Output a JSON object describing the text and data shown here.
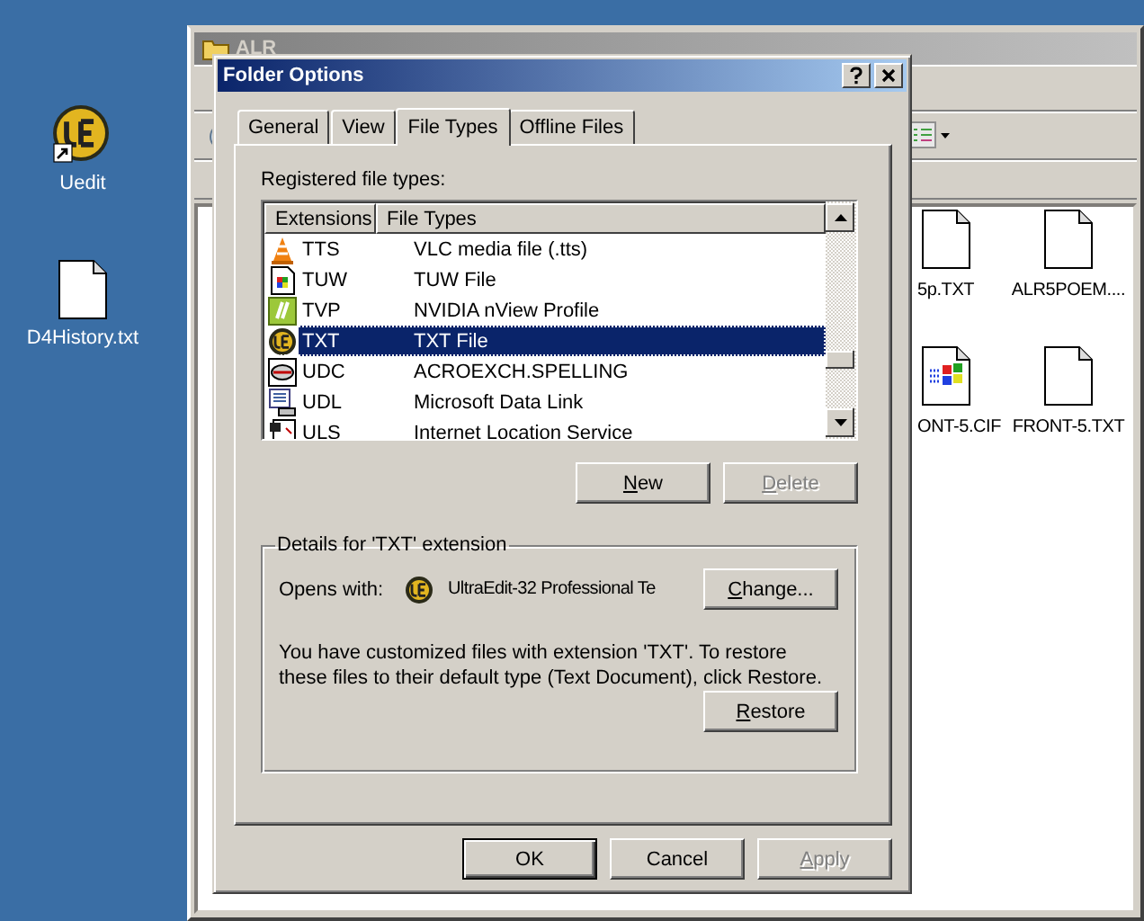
{
  "desktop_icons": [
    {
      "label": "Uedit",
      "kind": "app-shortcut"
    },
    {
      "label": "D4History.txt",
      "kind": "document"
    }
  ],
  "explorer": {
    "title": "ALR",
    "files": [
      {
        "label": "5p.TXT",
        "kind": "document"
      },
      {
        "label": "ALR5POEM....",
        "kind": "document"
      },
      {
        "label": "ONT-5.CIF",
        "kind": "setup"
      },
      {
        "label": "FRONT-5.TXT",
        "kind": "document"
      }
    ]
  },
  "dialog": {
    "title": "Folder Options",
    "tabs": [
      {
        "label": "General",
        "selected": false
      },
      {
        "label": "View",
        "selected": false
      },
      {
        "label": "File Types",
        "selected": true
      },
      {
        "label": "Offline Files",
        "selected": false
      }
    ],
    "list_label": "Registered file types:",
    "columns": [
      "Extensions",
      "File Types"
    ],
    "rows": [
      {
        "extension": "TTS",
        "file_type": "VLC media file (.tts)",
        "kind": "cone",
        "selected": false
      },
      {
        "extension": "TUW",
        "file_type": "TUW File",
        "kind": "windows-doc",
        "selected": false
      },
      {
        "extension": "TVP",
        "file_type": "NVIDIA nView Profile",
        "kind": "green-tile",
        "selected": false
      },
      {
        "extension": "TXT",
        "file_type": "TXT File",
        "kind": "ue",
        "selected": true
      },
      {
        "extension": "UDC",
        "file_type": "ACROEXCH.SPELLING",
        "kind": "disk",
        "selected": false
      },
      {
        "extension": "UDL",
        "file_type": "Microsoft Data Link",
        "kind": "datalink",
        "selected": false
      },
      {
        "extension": "ULS",
        "file_type": "Internet Location Service",
        "kind": "web",
        "selected": false
      }
    ],
    "list_buttons": [
      {
        "label": "New",
        "underlined_first": true,
        "disabled": false
      },
      {
        "label": "Delete",
        "underlined_first": true,
        "disabled": true
      }
    ],
    "details": {
      "legend": "Details for 'TXT' extension",
      "opens_with_label": "Opens with:",
      "app_name": "UltraEdit-32 Professional Te",
      "change_button": {
        "label": "Change...",
        "underlined_first": true,
        "disabled": false
      },
      "note": "You have customized files with extension 'TXT'.  To restore these files to their default type (Text Document), click Restore.",
      "restore_button": {
        "label": "Restore",
        "underlined_first": true,
        "disabled": false
      }
    },
    "buttons": [
      {
        "label": "OK",
        "underlined_first": false,
        "disabled": false,
        "default": true
      },
      {
        "label": "Cancel",
        "underlined_first": false,
        "disabled": false,
        "default": false
      },
      {
        "label": "Apply",
        "underlined_first": true,
        "disabled": true,
        "default": false
      }
    ]
  }
}
